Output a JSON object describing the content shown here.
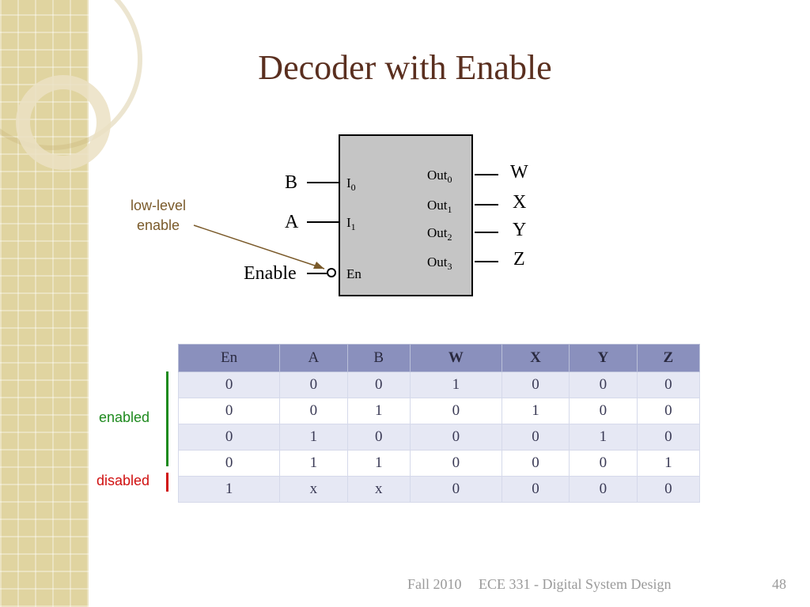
{
  "title": "Decoder with Enable",
  "low_level_note": "low-level enable",
  "inputs": {
    "b": "B",
    "a": "A",
    "enable": "Enable"
  },
  "internal": {
    "i0": "I",
    "i0_sub": "0",
    "i1": "I",
    "i1_sub": "1",
    "en": "En",
    "out0": "Out",
    "out0_sub": "0",
    "out1": "Out",
    "out1_sub": "1",
    "out2": "Out",
    "out2_sub": "2",
    "out3": "Out",
    "out3_sub": "3"
  },
  "outputs": {
    "w": "W",
    "x": "X",
    "y": "Y",
    "z": "Z"
  },
  "table": {
    "headers": [
      "En",
      "A",
      "B",
      "W",
      "X",
      "Y",
      "Z"
    ],
    "rows": [
      [
        "0",
        "0",
        "0",
        "1",
        "0",
        "0",
        "0"
      ],
      [
        "0",
        "0",
        "1",
        "0",
        "1",
        "0",
        "0"
      ],
      [
        "0",
        "1",
        "0",
        "0",
        "0",
        "1",
        "0"
      ],
      [
        "0",
        "1",
        "1",
        "0",
        "0",
        "0",
        "1"
      ],
      [
        "1",
        "x",
        "x",
        "0",
        "0",
        "0",
        "0"
      ]
    ]
  },
  "labels": {
    "enabled": "enabled",
    "disabled": "disabled"
  },
  "footer": {
    "term": "Fall 2010",
    "course": "ECE 331 - Digital System Design",
    "page": "48"
  }
}
